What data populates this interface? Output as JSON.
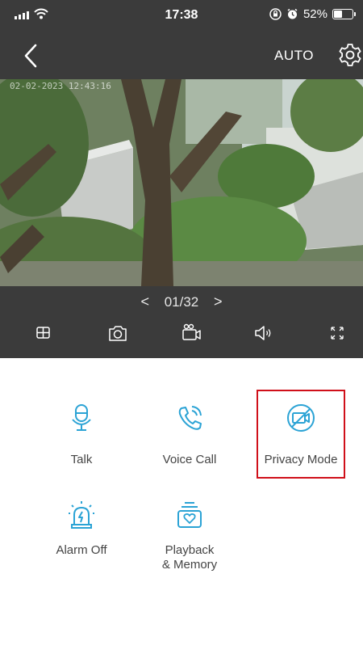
{
  "status_bar": {
    "time": "17:38",
    "battery_text": "52%",
    "battery_level": 0.52
  },
  "nav": {
    "back_icon": "chevron-left-icon",
    "mode_label": "AUTO",
    "settings_icon": "gear-icon"
  },
  "video": {
    "overlay_text": "02-02-2023 12:43:16"
  },
  "player": {
    "prev": "<",
    "page": "01/32",
    "next": ">"
  },
  "toolbar": {
    "icons": [
      "grid-layout-icon",
      "camera-snapshot-icon",
      "video-record-icon",
      "speaker-icon",
      "fullscreen-icon"
    ]
  },
  "features": {
    "talk": "Talk",
    "voice_call": "Voice Call",
    "privacy_mode": "Privacy Mode",
    "alarm_off": "Alarm Off",
    "playback_line1": "Playback",
    "playback_line2": "& Memory"
  },
  "colors": {
    "accent": "#2ba3d5",
    "dark_bar": "#3b3b3b",
    "highlight": "#d0101a"
  }
}
